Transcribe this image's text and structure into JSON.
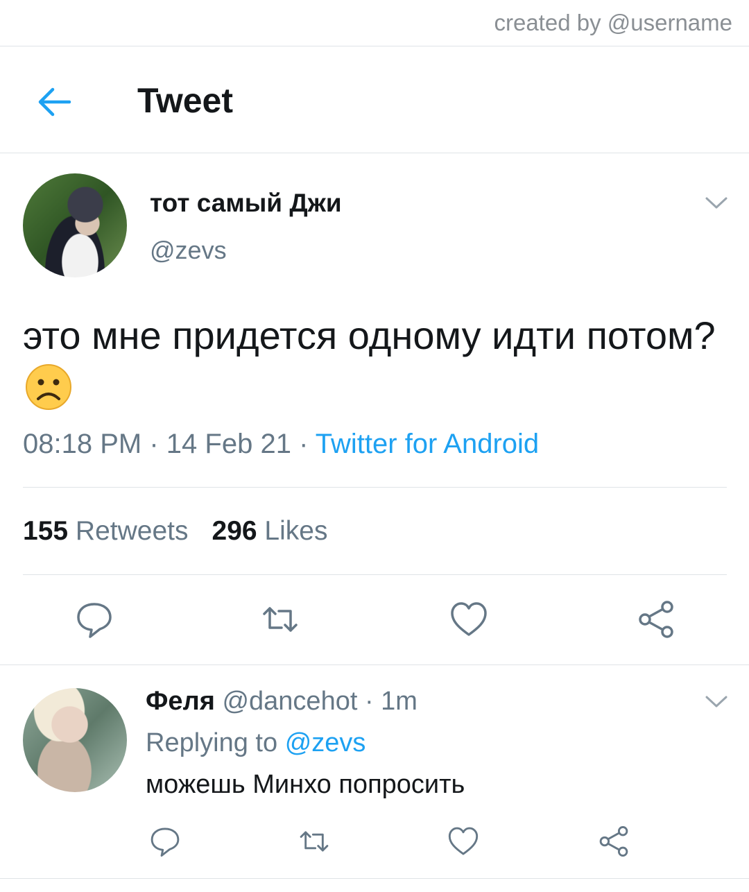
{
  "watermark": "created by @username",
  "header": {
    "title": "Tweet",
    "back_icon": "arrow-left-icon"
  },
  "colors": {
    "accent": "#1da1f2",
    "secondary_text": "#657786",
    "divider": "#dfe3e7"
  },
  "tweet": {
    "display_name": "тот самый Джи",
    "handle": "@zevs",
    "text": "это мне придется одному идти потом?",
    "emoji": "frowning-face",
    "time": "08:18 PM",
    "date": "14 Feb 21",
    "source": "Twitter for Android",
    "sep": "·",
    "retweets_count": "155",
    "retweets_label": "Retweets",
    "likes_count": "296",
    "likes_label": "Likes",
    "actions": [
      "reply-icon",
      "retweet-icon",
      "like-icon",
      "share-icon"
    ]
  },
  "reply": {
    "display_name": "Феля",
    "handle": "@dancehot",
    "sep": "·",
    "age": "1m",
    "replying_prefix": "Replying to",
    "replying_handle": "@zevs",
    "text": "можешь Минхо попросить",
    "actions": [
      "reply-icon",
      "retweet-icon",
      "like-icon",
      "share-icon"
    ]
  }
}
